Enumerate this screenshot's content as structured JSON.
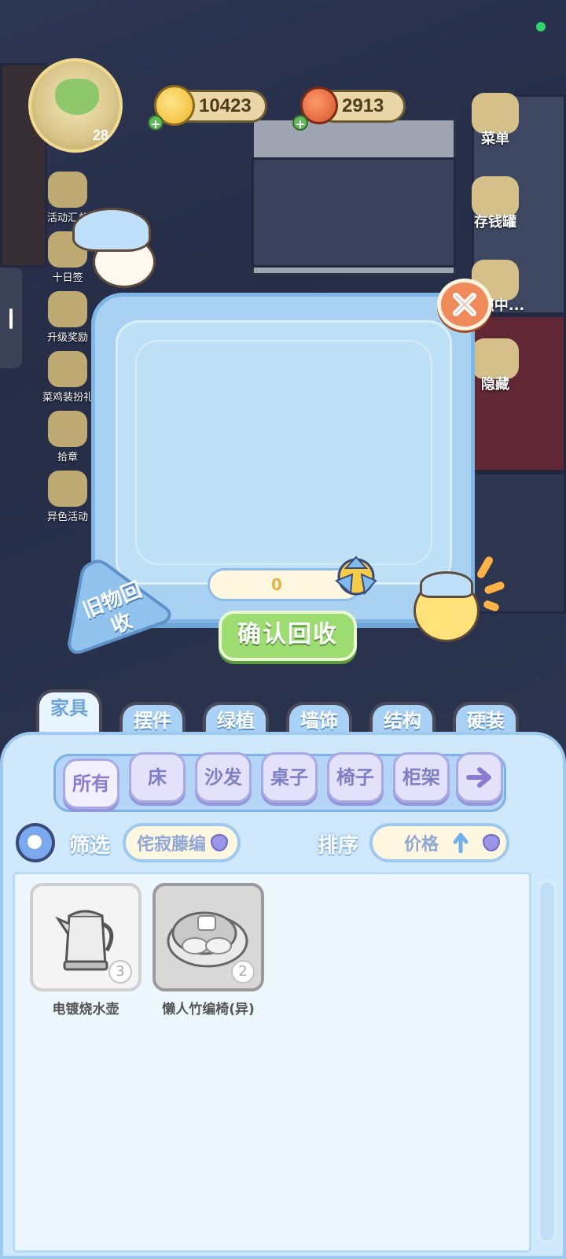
{
  "hud": {
    "level": "28",
    "coins": "10423",
    "vegetables": "2913"
  },
  "left_menu": [
    {
      "label": "活动汇总",
      "icon": "activity-summary-icon"
    },
    {
      "label": "十日签",
      "icon": "ten-day-checkin-icon"
    },
    {
      "label": "升级奖励",
      "icon": "level-up-reward-icon"
    },
    {
      "label": "菜鸡装扮礼",
      "icon": "chick-outfit-icon"
    },
    {
      "label": "拾章",
      "icon": "badge-collect-icon"
    },
    {
      "label": "异色活动",
      "icon": "rainbow-event-icon"
    }
  ],
  "right_menu": [
    {
      "label": "菜单",
      "icon": "menu-icon"
    },
    {
      "label": "存钱罐",
      "icon": "piggy-bank-icon"
    },
    {
      "label": "拍照中...",
      "icon": "camera-icon"
    },
    {
      "label": "隐藏",
      "icon": "hide-icon"
    }
  ],
  "recycle_dialog": {
    "tag": "旧物回收",
    "points": "0",
    "confirm_label": "确认回收"
  },
  "category_tabs": [
    {
      "label": "家具",
      "active": true
    },
    {
      "label": "摆件",
      "active": false
    },
    {
      "label": "绿植",
      "active": false
    },
    {
      "label": "墙饰",
      "active": false
    },
    {
      "label": "结构",
      "active": false
    },
    {
      "label": "硬装",
      "active": false
    }
  ],
  "sub_tabs": [
    {
      "label": "所有",
      "active": true
    },
    {
      "label": "床",
      "active": false
    },
    {
      "label": "沙发",
      "active": false
    },
    {
      "label": "桌子",
      "active": false
    },
    {
      "label": "椅子",
      "active": false
    },
    {
      "label": "柜架",
      "active": false
    }
  ],
  "filter": {
    "label": "筛选",
    "value": "侘寂藤编"
  },
  "sort": {
    "label": "排序",
    "value": "价格",
    "direction": "ascending"
  },
  "items": [
    {
      "name": "电镀烧水壶",
      "count": "3",
      "icon": "electric-kettle-icon"
    },
    {
      "name": "懒人竹编椅(异)",
      "count": "2",
      "icon": "bamboo-chair-icon"
    }
  ],
  "colors": {
    "confirm_green": "#9ddc71",
    "panel_blue": "#cfe8fb",
    "close_orange": "#f08a5a",
    "points_text": "#e8b44a"
  }
}
